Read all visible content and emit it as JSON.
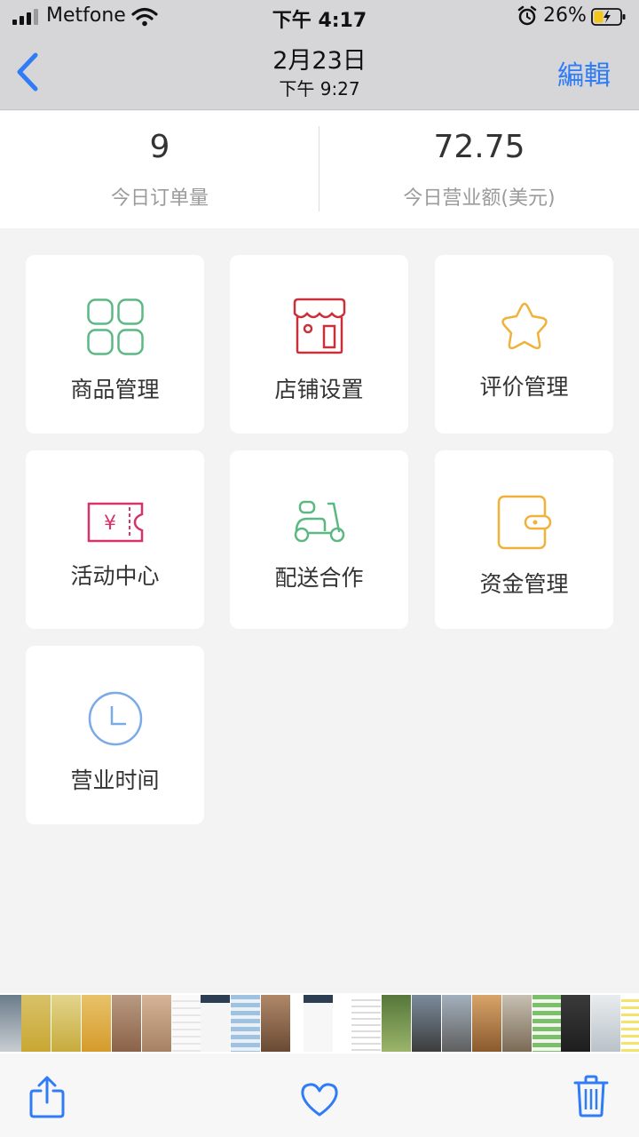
{
  "status_bar": {
    "carrier": "Metfone",
    "time": "下午 4:17",
    "battery_percent": "26%"
  },
  "nav": {
    "title": "2月23日",
    "subtitle": "下午 9:27",
    "edit_label": "編輯",
    "back_icon": "chevron-left-icon"
  },
  "stats": {
    "orders_today": {
      "value": "9",
      "label": "今日订单量"
    },
    "revenue_today": {
      "value": "72.75",
      "label": "今日营业额(美元)"
    }
  },
  "menu": [
    {
      "label": "商品管理",
      "icon": "product-grid-icon",
      "color": "#5cb883"
    },
    {
      "label": "店铺设置",
      "icon": "store-icon",
      "color": "#c9303a"
    },
    {
      "label": "评价管理",
      "icon": "star-icon",
      "color": "#f0b23a"
    },
    {
      "label": "活动中心",
      "icon": "coupon-icon",
      "color": "#d6336c"
    },
    {
      "label": "配送合作",
      "icon": "scooter-icon",
      "color": "#5cb883"
    },
    {
      "label": "资金管理",
      "icon": "wallet-icon",
      "color": "#f0b23a"
    },
    {
      "label": "营业时间",
      "icon": "clock-icon",
      "color": "#7aaae8"
    }
  ],
  "toolbar": {
    "share_icon": "share-icon",
    "favorite_icon": "heart-icon",
    "delete_icon": "trash-icon",
    "accent": "#2f7cf6"
  }
}
